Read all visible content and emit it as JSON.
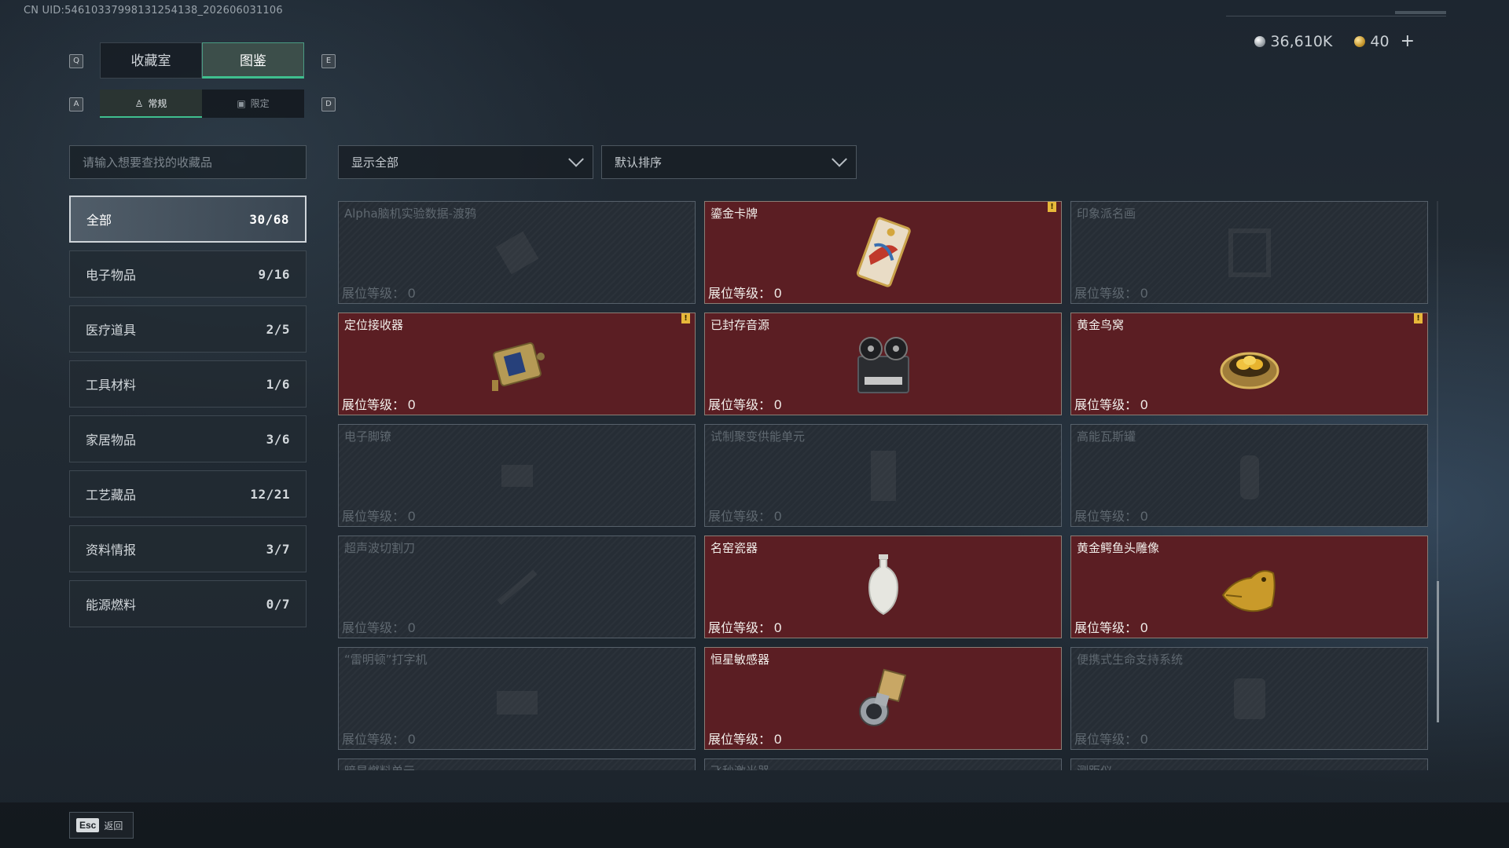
{
  "header": {
    "uid": "CN UID:546103379981312541​38_202606031106",
    "currency": {
      "silver_amount": "36,610K",
      "gold_amount": "40",
      "add_label": "+"
    }
  },
  "tabs": {
    "left_key": "Q",
    "right_key": "E",
    "items": [
      {
        "label": "收藏室",
        "active": false
      },
      {
        "label": "图鉴",
        "active": true
      }
    ]
  },
  "subtabs": {
    "left_key": "A",
    "right_key": "D",
    "items": [
      {
        "label": "常规",
        "icon": "figure-icon",
        "active": true
      },
      {
        "label": "限定",
        "icon": "image-icon",
        "active": false
      }
    ]
  },
  "search": {
    "placeholder": "请输入想要查找的收藏品",
    "value": ""
  },
  "categories": [
    {
      "label": "全部",
      "count": "30/68",
      "active": true
    },
    {
      "label": "电子物品",
      "count": "9/16"
    },
    {
      "label": "医疗道具",
      "count": "2/5"
    },
    {
      "label": "工具材料",
      "count": "1/6"
    },
    {
      "label": "家居物品",
      "count": "3/6"
    },
    {
      "label": "工艺藏品",
      "count": "12/21"
    },
    {
      "label": "资料情报",
      "count": "3/7"
    },
    {
      "label": "能源燃料",
      "count": "0/7"
    }
  ],
  "filters": {
    "display": "显示全部",
    "sort": "默认排序"
  },
  "level_label": "展位等级：",
  "items": [
    {
      "name": "Alpha脑机实验数据-渡鸦",
      "level": "0",
      "owned": false,
      "alert": false,
      "icon": "data-drive-icon"
    },
    {
      "name": "鎏金卡牌",
      "level": "0",
      "owned": true,
      "alert": true,
      "icon": "gilded-card-icon"
    },
    {
      "name": "印象派名画",
      "level": "0",
      "owned": false,
      "alert": false,
      "icon": "painting-icon"
    },
    {
      "name": "定位接收器",
      "level": "0",
      "owned": true,
      "alert": true,
      "icon": "receiver-icon"
    },
    {
      "name": "已封存音源",
      "level": "0",
      "owned": true,
      "alert": false,
      "icon": "tape-recorder-icon"
    },
    {
      "name": "黄金鸟窝",
      "level": "0",
      "owned": true,
      "alert": true,
      "icon": "golden-nest-icon"
    },
    {
      "name": "电子脚镣",
      "level": "0",
      "owned": false,
      "alert": false,
      "icon": "ankle-monitor-icon"
    },
    {
      "name": "试制聚变供能单元",
      "level": "0",
      "owned": false,
      "alert": false,
      "icon": "fusion-cell-icon"
    },
    {
      "name": "高能瓦斯罐",
      "level": "0",
      "owned": false,
      "alert": false,
      "icon": "gas-canister-icon"
    },
    {
      "name": "超声波切割刀",
      "level": "0",
      "owned": false,
      "alert": false,
      "icon": "ultrasonic-cutter-icon"
    },
    {
      "name": "名窑瓷器",
      "level": "0",
      "owned": true,
      "alert": false,
      "icon": "porcelain-vase-icon"
    },
    {
      "name": "黄金鳄鱼头雕像",
      "level": "0",
      "owned": true,
      "alert": false,
      "icon": "golden-crocodile-icon"
    },
    {
      "name": "“雷明顿”打字机",
      "level": "0",
      "owned": false,
      "alert": false,
      "icon": "typewriter-icon"
    },
    {
      "name": "恒星敏感器",
      "level": "0",
      "owned": true,
      "alert": false,
      "icon": "star-sensor-icon"
    },
    {
      "name": "便携式生命支持系统",
      "level": "0",
      "owned": false,
      "alert": false,
      "icon": "life-support-icon"
    },
    {
      "name": "暗星燃料单元",
      "level": "",
      "owned": false,
      "alert": false,
      "icon": "fuel-cell-icon"
    },
    {
      "name": "飞秒激光器",
      "level": "",
      "owned": false,
      "alert": false,
      "icon": "laser-icon"
    },
    {
      "name": "测距仪",
      "level": "",
      "owned": false,
      "alert": false,
      "icon": "rangefinder-icon"
    }
  ],
  "footer": {
    "esc_key": "Esc",
    "back_label": "返回"
  }
}
